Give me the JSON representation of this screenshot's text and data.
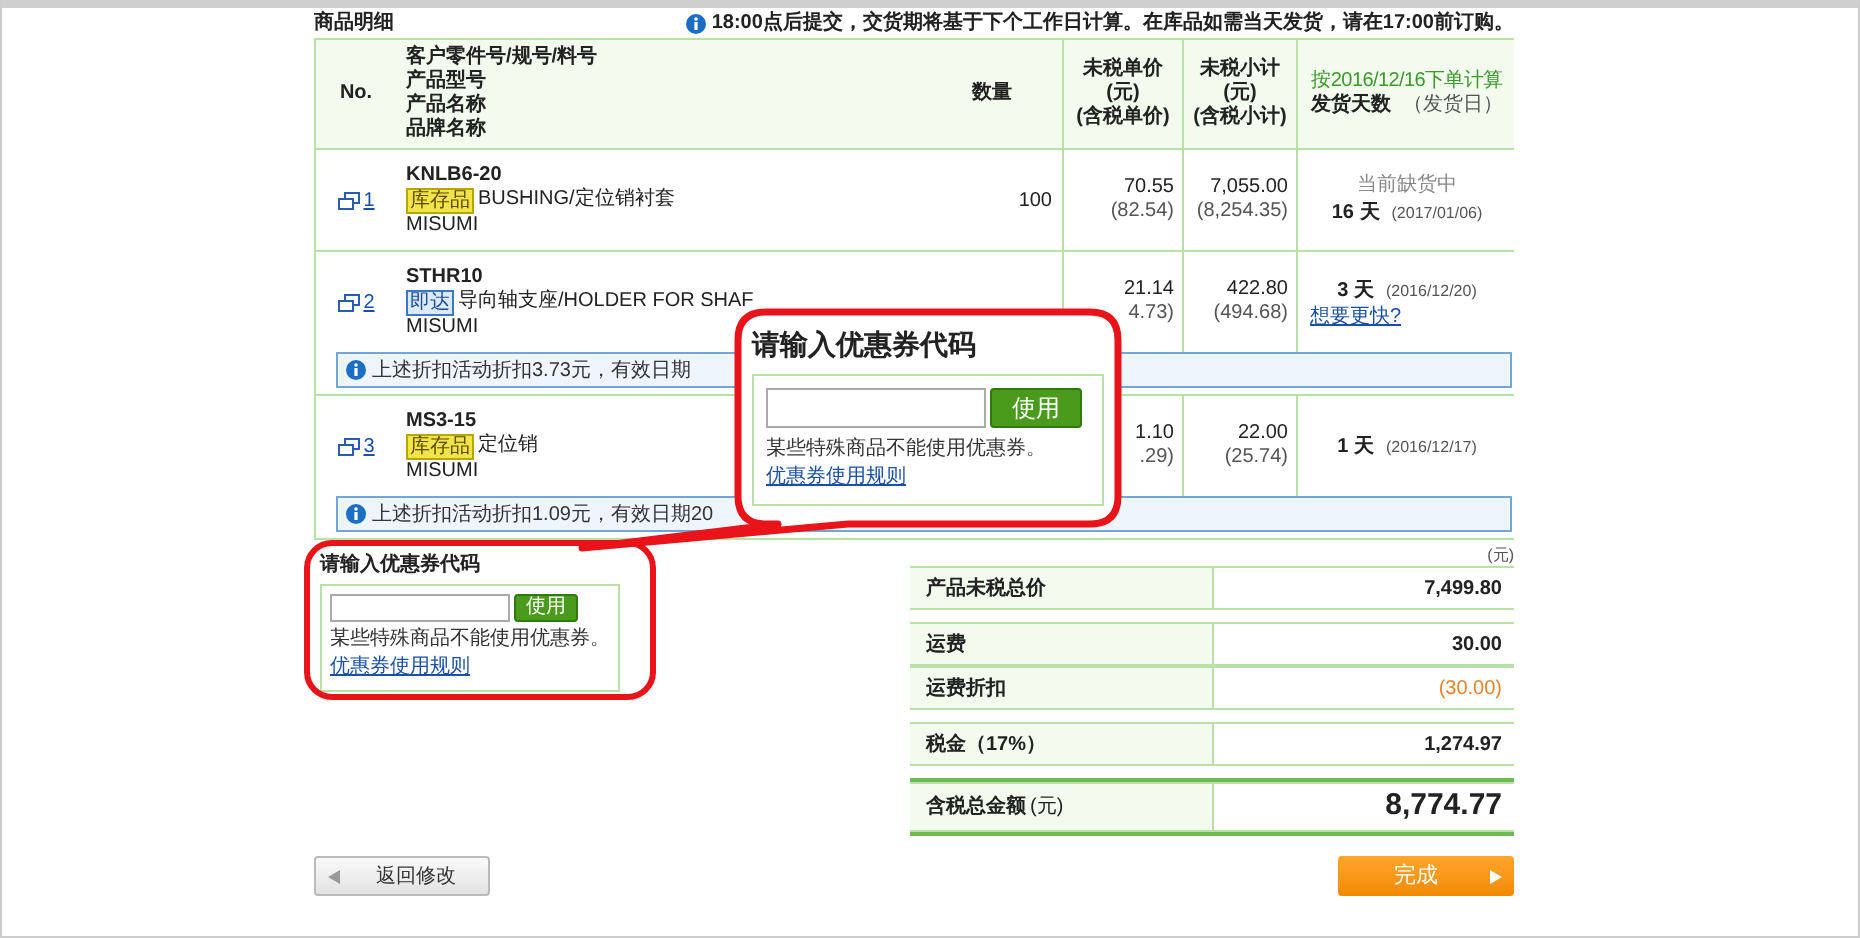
{
  "section_title": "商品明细",
  "notice": "18:00点后提交，交货期将基于下个工作日计算。在库品如需当天发货，请在17:00前订购。",
  "table": {
    "columns": [
      {
        "lines": [
          "No."
        ]
      },
      {
        "lines": [
          "客户零件号/规号/料号",
          "产品型号",
          "产品名称",
          "品牌名称"
        ]
      },
      {
        "lines": [
          "数量"
        ]
      },
      {
        "lines": [
          "未税单价",
          "(元)",
          "(含税单价)"
        ]
      },
      {
        "lines": [
          "未税小计",
          "(元)",
          "(含税小计)"
        ]
      },
      {
        "basis": "按2016/12/16下单计算",
        "lines": [
          "发货天数"
        ],
        "sub": "（发货日）"
      }
    ],
    "rows": [
      {
        "no": "1",
        "model": "KNLB6-20",
        "tag": {
          "kind": "stock",
          "label": "库存品"
        },
        "name": "BUSHING/定位销衬套",
        "brand": "MISUMI",
        "qty": "100",
        "unit_price": "70.55",
        "unit_price_tax": "(82.54)",
        "subtotal": "7,055.00",
        "subtotal_tax": "(8,254.35)",
        "stock_status": "当前缺货中",
        "days": "16 天",
        "ship_date": "(2017/01/06)"
      },
      {
        "no": "2",
        "model": "STHR10",
        "tag": {
          "kind": "express",
          "label": "即达"
        },
        "name": "导向轴支座/HOLDER FOR SHAF",
        "brand": "MISUMI",
        "unit_price": "21.14",
        "unit_price_tax": "4.73)",
        "subtotal": "422.80",
        "subtotal_tax": "(494.68)",
        "days": "3 天",
        "ship_date": "(2016/12/20)",
        "faster_link": "想要更快?",
        "note": "上述折扣活动折扣3.73元，有效日期"
      },
      {
        "no": "3",
        "model": "MS3-15",
        "tag": {
          "kind": "stock",
          "label": "库存品"
        },
        "name": "定位销",
        "brand": "MISUMI",
        "unit_price": "1.10",
        "unit_price_tax": ".29)",
        "subtotal": "22.00",
        "subtotal_tax": "(25.74)",
        "days": "1 天",
        "ship_date": "(2016/12/17)",
        "note": "上述折扣活动折扣1.09元，有效日期20"
      }
    ]
  },
  "coupon": {
    "title": "请输入优惠券代码",
    "button": "使用",
    "hint": "某些特殊商品不能使用优惠券。",
    "link": "优惠券使用规则"
  },
  "callout": {
    "title": "请输入优惠券代码",
    "button": "使用",
    "hint": "某些特殊商品不能使用优惠券。",
    "link": "优惠券使用规则"
  },
  "summary": {
    "unit": "(元)",
    "groups": [
      [
        {
          "label": "产品未税总价",
          "value": "7,499.80",
          "kind": "normal"
        }
      ],
      [
        {
          "label": "运费",
          "value": "30.00",
          "kind": "normal"
        },
        {
          "label": "运费折扣",
          "value": "(30.00)",
          "kind": "discount"
        }
      ],
      [
        {
          "label": "税金（17%）",
          "value": "1,274.97",
          "kind": "normal"
        }
      ],
      [
        {
          "label": "含税总金额",
          "label_unit": "(元)",
          "value": "8,774.77",
          "kind": "total"
        }
      ]
    ]
  },
  "buttons": {
    "back": "返回修改",
    "finish": "完成"
  }
}
